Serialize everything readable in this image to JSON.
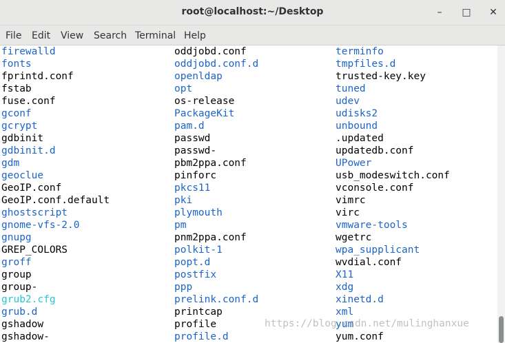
{
  "window": {
    "title": "root@localhost:~/Desktop",
    "minimize_glyph": "–",
    "maximize_glyph": "□",
    "close_glyph": "✕"
  },
  "menu": [
    "File",
    "Edit",
    "View",
    "Search",
    "Terminal",
    "Help"
  ],
  "colors": {
    "file": "#000000",
    "directory": "#1b64c8",
    "symlink": "#26c6d8"
  },
  "columns": [
    [
      {
        "name": "firewalld",
        "kind": "d"
      },
      {
        "name": "fonts",
        "kind": "d"
      },
      {
        "name": "fprintd.conf",
        "kind": "f"
      },
      {
        "name": "fstab",
        "kind": "f"
      },
      {
        "name": "fuse.conf",
        "kind": "f"
      },
      {
        "name": "gconf",
        "kind": "d"
      },
      {
        "name": "gcrypt",
        "kind": "d"
      },
      {
        "name": "gdbinit",
        "kind": "f"
      },
      {
        "name": "gdbinit.d",
        "kind": "d"
      },
      {
        "name": "gdm",
        "kind": "d"
      },
      {
        "name": "geoclue",
        "kind": "d"
      },
      {
        "name": "GeoIP.conf",
        "kind": "f"
      },
      {
        "name": "GeoIP.conf.default",
        "kind": "f"
      },
      {
        "name": "ghostscript",
        "kind": "d"
      },
      {
        "name": "gnome-vfs-2.0",
        "kind": "d"
      },
      {
        "name": "gnupg",
        "kind": "d"
      },
      {
        "name": "GREP_COLORS",
        "kind": "f"
      },
      {
        "name": "groff",
        "kind": "d"
      },
      {
        "name": "group",
        "kind": "f"
      },
      {
        "name": "group-",
        "kind": "f"
      },
      {
        "name": "grub2.cfg",
        "kind": "l"
      },
      {
        "name": "grub.d",
        "kind": "d"
      },
      {
        "name": "gshadow",
        "kind": "f"
      },
      {
        "name": "gshadow-",
        "kind": "f"
      }
    ],
    [
      {
        "name": "oddjobd.conf",
        "kind": "f"
      },
      {
        "name": "oddjobd.conf.d",
        "kind": "d"
      },
      {
        "name": "openldap",
        "kind": "d"
      },
      {
        "name": "opt",
        "kind": "d"
      },
      {
        "name": "os-release",
        "kind": "f"
      },
      {
        "name": "PackageKit",
        "kind": "d"
      },
      {
        "name": "pam.d",
        "kind": "d"
      },
      {
        "name": "passwd",
        "kind": "f"
      },
      {
        "name": "passwd-",
        "kind": "f"
      },
      {
        "name": "pbm2ppa.conf",
        "kind": "f"
      },
      {
        "name": "pinforc",
        "kind": "f"
      },
      {
        "name": "pkcs11",
        "kind": "d"
      },
      {
        "name": "pki",
        "kind": "d"
      },
      {
        "name": "plymouth",
        "kind": "d"
      },
      {
        "name": "pm",
        "kind": "d"
      },
      {
        "name": "pnm2ppa.conf",
        "kind": "f"
      },
      {
        "name": "polkit-1",
        "kind": "d"
      },
      {
        "name": "popt.d",
        "kind": "d"
      },
      {
        "name": "postfix",
        "kind": "d"
      },
      {
        "name": "ppp",
        "kind": "d"
      },
      {
        "name": "prelink.conf.d",
        "kind": "d"
      },
      {
        "name": "printcap",
        "kind": "f"
      },
      {
        "name": "profile",
        "kind": "f"
      },
      {
        "name": "profile.d",
        "kind": "d"
      }
    ],
    [
      {
        "name": "terminfo",
        "kind": "d"
      },
      {
        "name": "tmpfiles.d",
        "kind": "d"
      },
      {
        "name": "trusted-key.key",
        "kind": "f"
      },
      {
        "name": "tuned",
        "kind": "d"
      },
      {
        "name": "udev",
        "kind": "d"
      },
      {
        "name": "udisks2",
        "kind": "d"
      },
      {
        "name": "unbound",
        "kind": "d"
      },
      {
        "name": ".updated",
        "kind": "f"
      },
      {
        "name": "updatedb.conf",
        "kind": "f"
      },
      {
        "name": "UPower",
        "kind": "d"
      },
      {
        "name": "usb_modeswitch.conf",
        "kind": "f"
      },
      {
        "name": "vconsole.conf",
        "kind": "f"
      },
      {
        "name": "vimrc",
        "kind": "f"
      },
      {
        "name": "virc",
        "kind": "f"
      },
      {
        "name": "vmware-tools",
        "kind": "d"
      },
      {
        "name": "wgetrc",
        "kind": "f"
      },
      {
        "name": "wpa_supplicant",
        "kind": "d"
      },
      {
        "name": "wvdial.conf",
        "kind": "f"
      },
      {
        "name": "X11",
        "kind": "d"
      },
      {
        "name": "xdg",
        "kind": "d"
      },
      {
        "name": "xinetd.d",
        "kind": "d"
      },
      {
        "name": "xml",
        "kind": "d"
      },
      {
        "name": "yum",
        "kind": "d"
      },
      {
        "name": "yum.conf",
        "kind": "f"
      }
    ]
  ],
  "watermark": "https://blog.csdn.net/mulinghanxue"
}
